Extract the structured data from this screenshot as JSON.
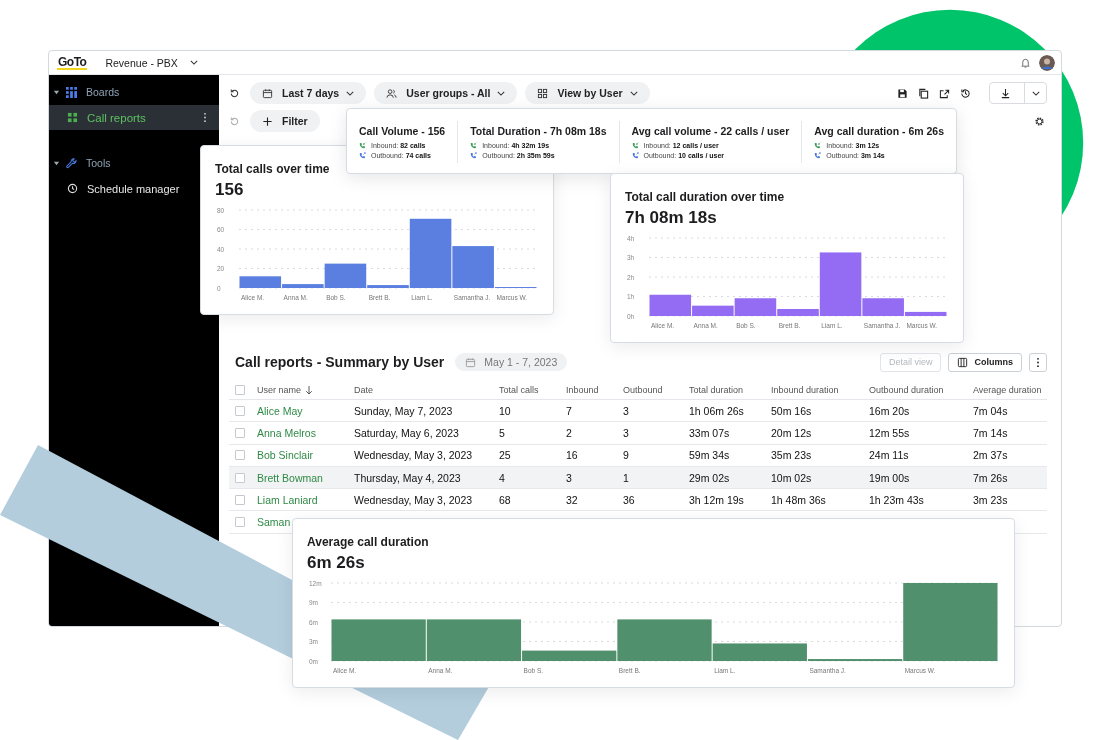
{
  "window": {
    "logo": "GoTo",
    "board": "Revenue - PBX"
  },
  "sidebar": [
    {
      "label": "Boards",
      "kind": "boards",
      "expanded": true,
      "items": [
        {
          "label": "Call reports",
          "kind": "report",
          "selected": true
        }
      ]
    },
    {
      "label": "Tools",
      "kind": "tools",
      "expanded": true,
      "items": [
        {
          "label": "Schedule manager",
          "kind": "schedule",
          "selected": false
        }
      ]
    }
  ],
  "toolbar": {
    "dropdowns": [
      {
        "label": "Last 7 days",
        "kind": "date"
      },
      {
        "label": "User groups - All",
        "kind": "users"
      },
      {
        "label": "View by User",
        "kind": "view"
      }
    ],
    "filter": "Filter"
  },
  "summary": [
    {
      "title": "Call Volume - 156",
      "lines": [
        {
          "kind": "inbound",
          "text": "Inbound: **82 calls**"
        },
        {
          "kind": "outbound",
          "text": "Outbound: **74 calls**"
        }
      ]
    },
    {
      "title": "Total Duration - 7h 08m 18s",
      "lines": [
        {
          "kind": "inbound",
          "text": "Inbound: **4h 32m 19s**"
        },
        {
          "kind": "outbound",
          "text": "Outbound: **2h 35m 59s**"
        }
      ]
    },
    {
      "title": "Avg call volume - 22 calls / user",
      "lines": [
        {
          "kind": "inbound",
          "text": "Inbound: **12 calls / user**"
        },
        {
          "kind": "outbound",
          "text": "Outbound: **10 calls / user**"
        }
      ]
    },
    {
      "title": "Avg call duration - 6m 26s",
      "lines": [
        {
          "kind": "inbound",
          "text": "Inbound: **3m 12s**"
        },
        {
          "kind": "outbound",
          "text": "Outbound: **3m 14s**"
        }
      ]
    }
  ],
  "charts": [
    {
      "title": "Total calls over time",
      "total": "156",
      "chart_data": {
        "type": "bar",
        "categories": [
          "Alice M.",
          "Anna M.",
          "Bob S.",
          "Brett B.",
          "Liam L.",
          "Samantha J.",
          "Marcus W."
        ],
        "series": [
          {
            "color": "#5a7fe0",
            "values": [
              12,
              4,
              25,
              3,
              71,
              43,
              1
            ]
          }
        ],
        "grid": true,
        "ylim": [
          0,
          80
        ],
        "yticks": [
          0,
          20,
          40,
          60,
          80
        ]
      }
    },
    {
      "title": "Total call duration over time",
      "total": "7h 08m 18s",
      "chart_data": {
        "type": "bar",
        "categories": [
          "Alice M.",
          "Anna M.",
          "Bob S.",
          "Brett B.",
          "Liam L.",
          "Samantha J.",
          "Marcus W."
        ],
        "series": [
          {
            "color": "#936cf3",
            "values": [
              1.09,
              0.53,
              0.91,
              0.36,
              3.26,
              0.91,
              0.21
            ]
          }
        ],
        "grid": true,
        "ylim": [
          0,
          4
        ],
        "yticks": [
          {
            "value": 0,
            "label": "0h"
          },
          {
            "value": 1,
            "label": "1h"
          },
          {
            "value": 2,
            "label": "2h"
          },
          {
            "value": 3,
            "label": "3h"
          },
          {
            "value": 4,
            "label": "4h"
          }
        ]
      }
    },
    {
      "title": "Average call duration",
      "total": "6m 26s",
      "chart_data": {
        "type": "bar",
        "categories": [
          "Alice M.",
          "Anna M.",
          "Bob S.",
          "Brett B.",
          "Liam L.",
          "Samantha J.",
          "Marcus W."
        ],
        "series": [
          {
            "color": "#51906c",
            "values": [
              6.4,
              6.4,
              1.6,
              6.4,
              2.7,
              0.3,
              12
            ]
          }
        ],
        "grid": true,
        "ylim": [
          0,
          12
        ],
        "yticks": [
          {
            "value": 0,
            "label": "0m"
          },
          {
            "value": 3,
            "label": "3m"
          },
          {
            "value": 6,
            "label": "6m"
          },
          {
            "value": 9,
            "label": "9m"
          },
          {
            "value": 12,
            "label": "12m"
          }
        ]
      }
    }
  ],
  "table": {
    "title": "Call reports - Summary by User",
    "date_range": "May 1 - 7, 2023",
    "buttons": [
      {
        "label": "Detail view",
        "kind": "text",
        "disabled": true
      },
      {
        "label": "Columns",
        "kind": "columns",
        "disabled": false
      }
    ],
    "header_checked": false,
    "columns": [
      {
        "label": "User name",
        "sorted": true
      },
      {
        "label": "Date",
        "sorted": false
      },
      {
        "label": "Total calls",
        "sorted": false
      },
      {
        "label": "Inbound",
        "sorted": false
      },
      {
        "label": "Outbound",
        "sorted": false
      },
      {
        "label": "Total duration",
        "sorted": false
      },
      {
        "label": "Inbound duration",
        "sorted": false
      },
      {
        "label": "Outbound duration",
        "sorted": false
      },
      {
        "label": "Average duration",
        "sorted": false
      }
    ],
    "rows": [
      {
        "checked": false,
        "highlighted": false,
        "cells": [
          "Alice May",
          "Sunday, May 7, 2023",
          "10",
          "7",
          "3",
          "1h 06m 26s",
          "50m 16s",
          "16m 20s",
          "7m 04s"
        ]
      },
      {
        "checked": false,
        "highlighted": false,
        "cells": [
          "Anna Melros",
          "Saturday, May 6, 2023",
          "5",
          "2",
          "3",
          "33m 07s",
          "20m 12s",
          "12m 55s",
          "7m 14s"
        ]
      },
      {
        "checked": false,
        "highlighted": false,
        "cells": [
          "Bob Sinclair",
          "Wednesday, May 3, 2023",
          "25",
          "16",
          "9",
          "59m 34s",
          "35m 23s",
          "24m 11s",
          "2m 37s"
        ]
      },
      {
        "checked": false,
        "highlighted": true,
        "cells": [
          "Brett Bowman",
          "Thursday, May 4, 2023",
          "4",
          "3",
          "1",
          "29m 02s",
          "10m 02s",
          "19m 00s",
          "7m 26s"
        ]
      },
      {
        "checked": false,
        "highlighted": false,
        "cells": [
          "Liam Laniard",
          "Wednesday, May 3, 2023",
          "68",
          "32",
          "36",
          "3h 12m 19s",
          "1h 48m 36s",
          "1h 23m 43s",
          "3m 23s"
        ]
      },
      {
        "checked": false,
        "highlighted": false,
        "cells": [
          "Saman"
        ]
      }
    ]
  }
}
